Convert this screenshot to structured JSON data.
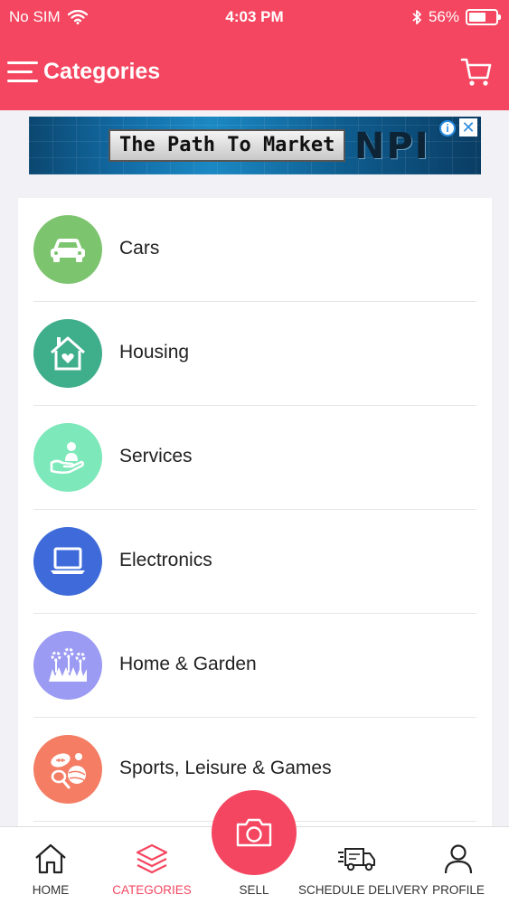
{
  "status_bar": {
    "carrier": "No SIM",
    "time": "4:03 PM",
    "battery": "56%",
    "battery_level": 0.56
  },
  "header": {
    "title": "Categories",
    "menu_icon": "hamburger-menu-icon",
    "cart_icon": "shopping-cart-icon"
  },
  "ad": {
    "headline": "The Path To Market",
    "brand": "NPI",
    "info": "i",
    "close": "✕"
  },
  "categories": [
    {
      "label": "Cars",
      "icon": "car-icon",
      "color": "#7dc46f"
    },
    {
      "label": "Housing",
      "icon": "house-heart-icon",
      "color": "#3fae8a"
    },
    {
      "label": "Services",
      "icon": "hand-person-icon",
      "color": "#7de8ba"
    },
    {
      "label": "Electronics",
      "icon": "laptop-icon",
      "color": "#3e6bd9"
    },
    {
      "label": "Home & Garden",
      "icon": "flowers-icon",
      "color": "#9b9bf3"
    },
    {
      "label": "Sports, Leisure & Games",
      "icon": "sports-balls-icon",
      "color": "#f47d64"
    }
  ],
  "tab_bar": {
    "home": "HOME",
    "categories": "CATEGORIES",
    "sell": "SELL",
    "schedule_delivery": "SCHEDULE DELIVERY",
    "profile": "PROFILE",
    "active_tab": "categories"
  },
  "colors": {
    "brand": "#f44660",
    "background": "#f2f1f5"
  }
}
